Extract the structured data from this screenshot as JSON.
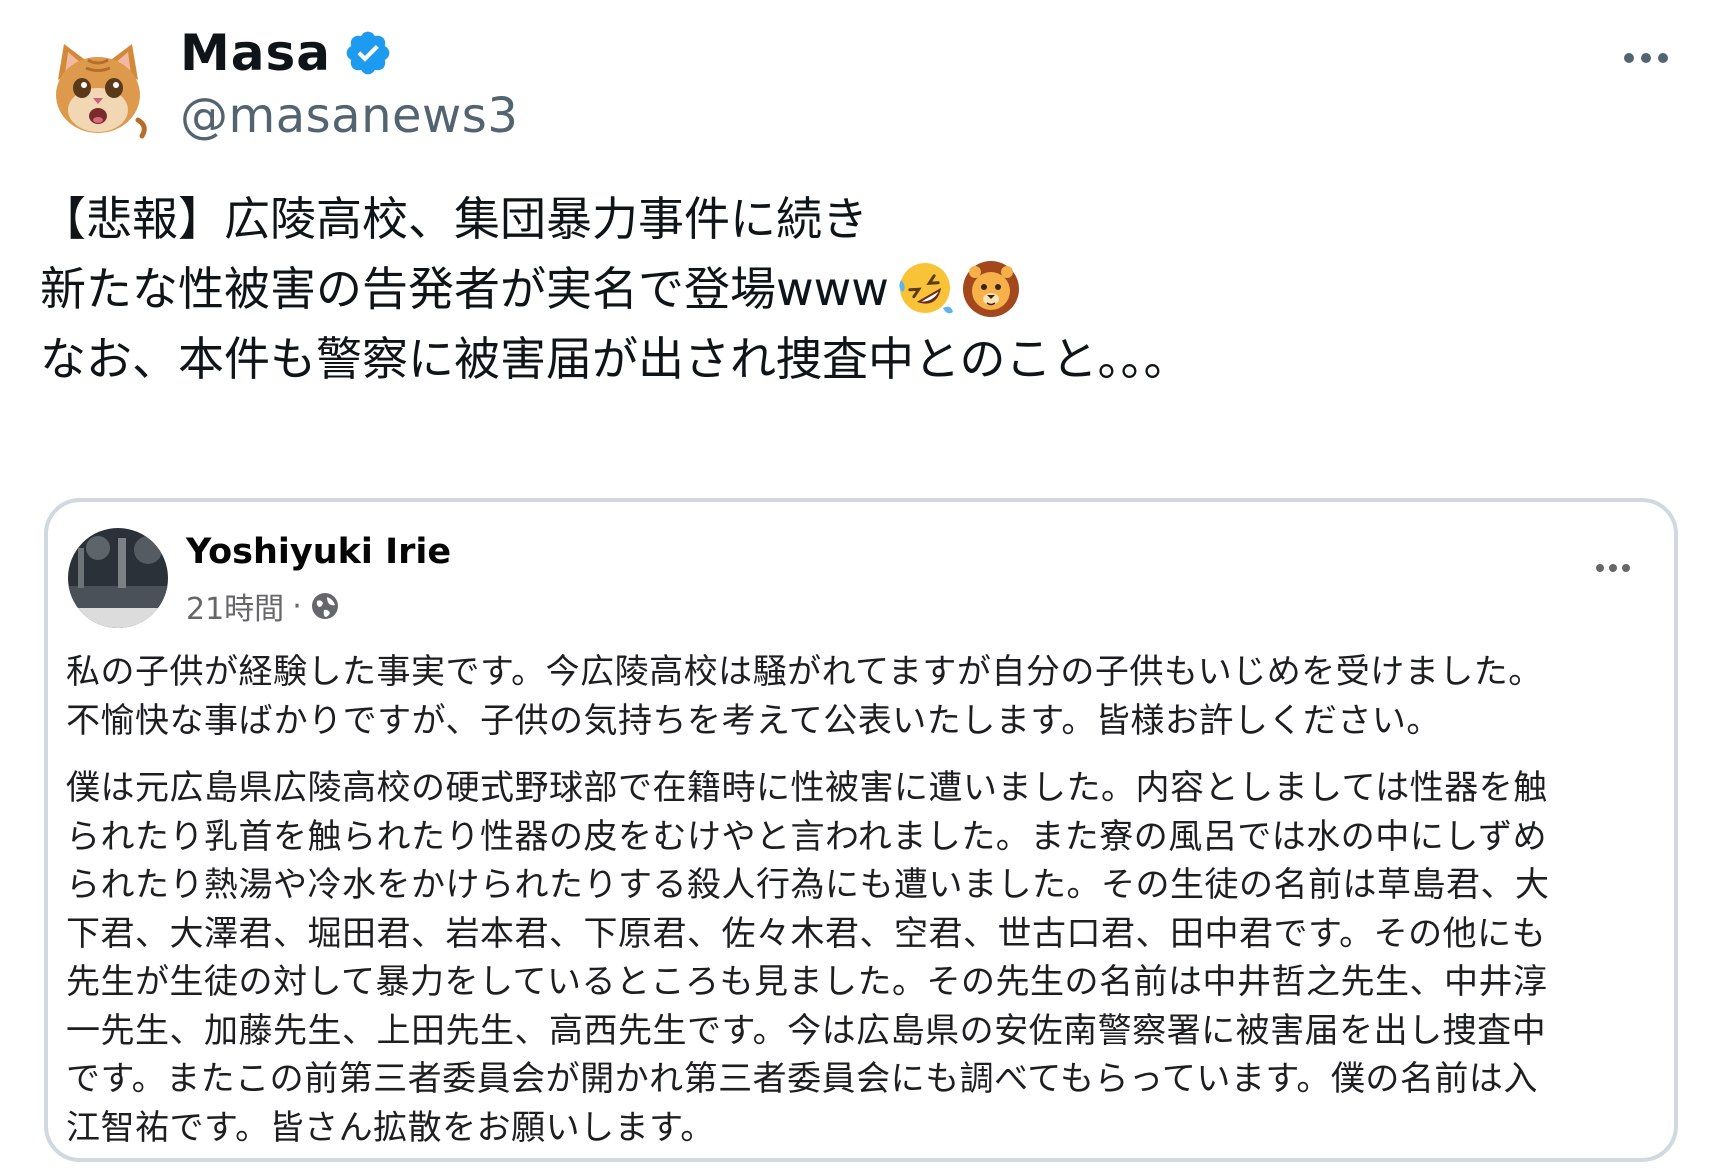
{
  "tweet": {
    "author": {
      "display_name": "Masa",
      "handle": "@masanews3",
      "verified": true,
      "avatar_icon": "cat-face-avatar"
    },
    "more_icon": "ellipsis-icon",
    "text_lines": [
      "【悲報】広陵高校、集団暴力事件に続き",
      "新たな性被害の告発者が実名で登場www",
      "なお、本件も警察に被害届が出され捜査中とのこと。。。"
    ],
    "emojis": [
      "rolling-on-floor-laughing-emoji",
      "lion-face-emoji"
    ]
  },
  "embedded_post": {
    "author_name": "Yoshiyuki Irie",
    "time": "21時間",
    "separator": "·",
    "audience_icon": "globe-icon",
    "paragraph1_lines": [
      "私の子供が経験した事実です。今広陵高校は騒がれてますが自分の子供もいじめを受けました。",
      "不愉快な事ばかりですが、子供の気持ちを考えて公表いたします。皆様お許しください。"
    ],
    "paragraph2_lines": [
      "僕は元広島県広陵高校の硬式野球部で在籍時に性被害に遭いました。内容としましては性器を触",
      "られたり乳首を触られたり性器の皮をむけやと言われました。また寮の風呂では水の中にしずめ",
      "られたり熱湯や冷水をかけられたりする殺人行為にも遭いました。その生徒の名前は草島君、大",
      "下君、大澤君、堀田君、岩本君、下原君、佐々木君、空君、世古口君、田中君です。その他にも",
      "先生が生徒の対して暴力をしているところも見ました。その先生の名前は中井哲之先生、中井淳",
      "一先生、加藤先生、上田先生、高西先生です。今は広島県の安佐南警察署に被害届を出し捜査中",
      "です。またこの前第三者委員会が開かれ第三者委員会にも調べてもらっています。僕の名前は入",
      "江智祐です。皆さん拡散をお願いします。"
    ]
  },
  "colors": {
    "verified_blue": "#1d9bf0",
    "handle_gray": "#536471",
    "card_border": "#cfd9de"
  }
}
